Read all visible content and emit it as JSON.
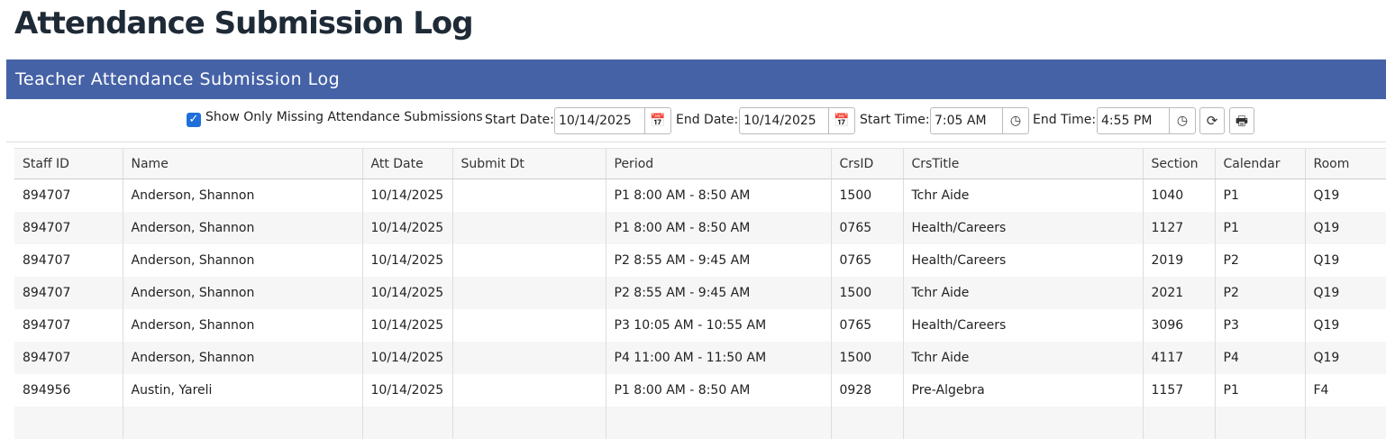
{
  "page_title": "Attendance Submission Log",
  "panel_title": "Teacher Attendance Submission Log",
  "filters": {
    "missing_only_label": "Show Only Missing Attendance Submissions",
    "missing_only_checked": true,
    "start_date_label": "Start Date:",
    "start_date_value": "10/14/2025",
    "end_date_label": "End Date:",
    "end_date_value": "10/14/2025",
    "start_time_label": "Start Time:",
    "start_time_value": "7:05 AM",
    "end_time_label": "End Time:",
    "end_time_value": "4:55 PM"
  },
  "icons": {
    "checkbox": "check-icon",
    "calendar": "calendar-icon",
    "clock": "clock-icon",
    "refresh": "refresh-icon",
    "print": "print-icon"
  },
  "colors": {
    "header_bg": "#4662a6",
    "checkbox": "#1f6fd9"
  },
  "table": {
    "columns": [
      "Staff ID",
      "Name",
      "Att Date",
      "Submit Dt",
      "Period",
      "CrsID",
      "CrsTitle",
      "Section",
      "Calendar",
      "Room"
    ],
    "rows": [
      [
        "894707",
        "Anderson, Shannon",
        "10/14/2025",
        "",
        "P1 8:00 AM - 8:50 AM",
        "1500",
        "Tchr Aide",
        "1040",
        "P1",
        "Q19"
      ],
      [
        "894707",
        "Anderson, Shannon",
        "10/14/2025",
        "",
        "P1 8:00 AM - 8:50 AM",
        "0765",
        "Health/Careers",
        "1127",
        "P1",
        "Q19"
      ],
      [
        "894707",
        "Anderson, Shannon",
        "10/14/2025",
        "",
        "P2 8:55 AM - 9:45 AM",
        "0765",
        "Health/Careers",
        "2019",
        "P2",
        "Q19"
      ],
      [
        "894707",
        "Anderson, Shannon",
        "10/14/2025",
        "",
        "P2 8:55 AM - 9:45 AM",
        "1500",
        "Tchr Aide",
        "2021",
        "P2",
        "Q19"
      ],
      [
        "894707",
        "Anderson, Shannon",
        "10/14/2025",
        "",
        "P3 10:05 AM - 10:55 AM",
        "0765",
        "Health/Careers",
        "3096",
        "P3",
        "Q19"
      ],
      [
        "894707",
        "Anderson, Shannon",
        "10/14/2025",
        "",
        "P4 11:00 AM - 11:50 AM",
        "1500",
        "Tchr Aide",
        "4117",
        "P4",
        "Q19"
      ],
      [
        "894956",
        "Austin, Yareli",
        "10/14/2025",
        "",
        "P1 8:00 AM - 8:50 AM",
        "0928",
        "Pre-Algebra",
        "1157",
        "P1",
        "F4"
      ],
      [
        "",
        "",
        "",
        "",
        "",
        "",
        "",
        "",
        "",
        ""
      ]
    ]
  }
}
